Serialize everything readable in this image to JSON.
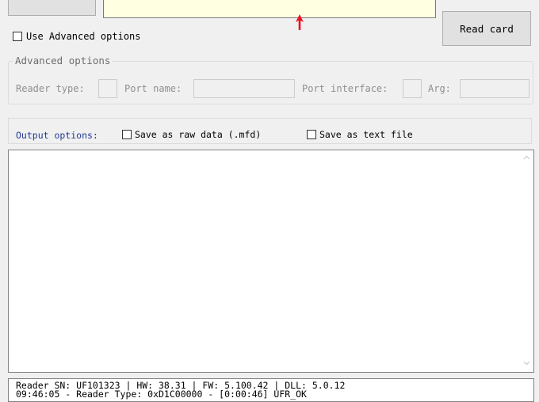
{
  "read_card_label": "Read card",
  "advanced_checkbox_label": "Use Advanced options",
  "advanced_group_title": "Advanced options",
  "advanced": {
    "reader_type_label": "Reader type:",
    "port_name_label": "Port name:",
    "port_interface_label": "Port interface:",
    "arg_label": "Arg:"
  },
  "output": {
    "label": "Output options:",
    "save_raw_label": "Save as raw data (.mfd)",
    "save_text_label": "Save as text file"
  },
  "status": {
    "line1": "Reader SN: UF101323 | HW: 38.31 | FW: 5.100.42 | DLL: 5.0.12",
    "line2": "09:46:05 - Reader Type: 0xD1C00000 - [0:00:46] UFR_OK"
  },
  "colors": {
    "yellow_field": "#ffffe1",
    "arrow": "#e81123",
    "output_label": "#1f3a93"
  }
}
